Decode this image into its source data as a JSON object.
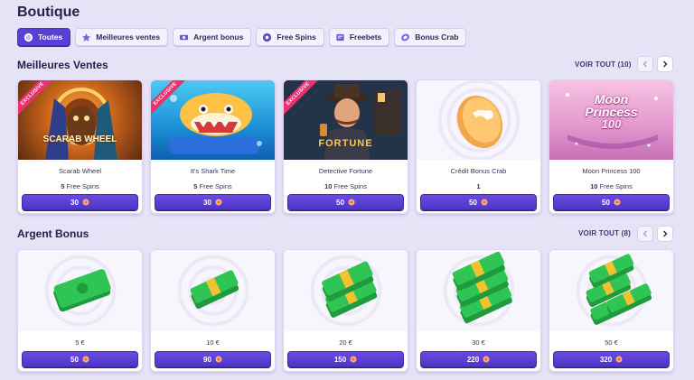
{
  "page": {
    "title": "Boutique"
  },
  "tabs": [
    {
      "label": "Toutes",
      "icon": "coin-pouch-icon",
      "active": true
    },
    {
      "label": "Meilleures ventes",
      "icon": "star-icon",
      "active": false
    },
    {
      "label": "Argent bonus",
      "icon": "cash-icon",
      "active": false
    },
    {
      "label": "Free Spins",
      "icon": "spin-icon",
      "active": false
    },
    {
      "label": "Freebets",
      "icon": "ticket-icon",
      "active": false
    },
    {
      "label": "Bonus Crab",
      "icon": "crab-coin-icon",
      "active": false
    }
  ],
  "sections": [
    {
      "title": "Meilleures Ventes",
      "see_all": "VOIR TOUT (10)",
      "items": [
        {
          "name": "Scarab Wheel",
          "qty": "5",
          "unit": "Free Spins",
          "price": "30",
          "exclusive": true,
          "theme": "scarab"
        },
        {
          "name": "It's Shark Time",
          "qty": "5",
          "unit": "Free Spins",
          "price": "30",
          "exclusive": true,
          "theme": "shark"
        },
        {
          "name": "Detective Fortune",
          "qty": "10",
          "unit": "Free Spins",
          "price": "50",
          "exclusive": true,
          "theme": "detective"
        },
        {
          "name": "Crédit Bonus Crab",
          "qty": "1",
          "unit": "",
          "price": "50",
          "exclusive": false,
          "theme": "crab"
        },
        {
          "name": "Moon Princess 100",
          "qty": "10",
          "unit": "Free Spins",
          "price": "50",
          "exclusive": false,
          "theme": "moon"
        }
      ]
    },
    {
      "title": "Argent Bonus",
      "see_all": "VOIR TOUT (8)",
      "items": [
        {
          "amount": "5 €",
          "price": "50",
          "stacks": 1
        },
        {
          "amount": "10 €",
          "price": "90",
          "stacks": 1
        },
        {
          "amount": "20 €",
          "price": "150",
          "stacks": 2
        },
        {
          "amount": "30 €",
          "price": "220",
          "stacks": 3
        },
        {
          "amount": "50 €",
          "price": "320",
          "stacks": 4
        }
      ]
    }
  ],
  "labels": {
    "exclusive": "EXCLUSIVE",
    "scarab_logo": "SCARAB WHEEL",
    "detective_logo": "FORTUNE",
    "moon_logo_1": "Moon",
    "moon_logo_2": "Princess",
    "moon_logo_3": "100"
  },
  "colors": {
    "accent": "#5a3fd6",
    "background": "#e7e3f7",
    "badge": "#e8336f"
  }
}
